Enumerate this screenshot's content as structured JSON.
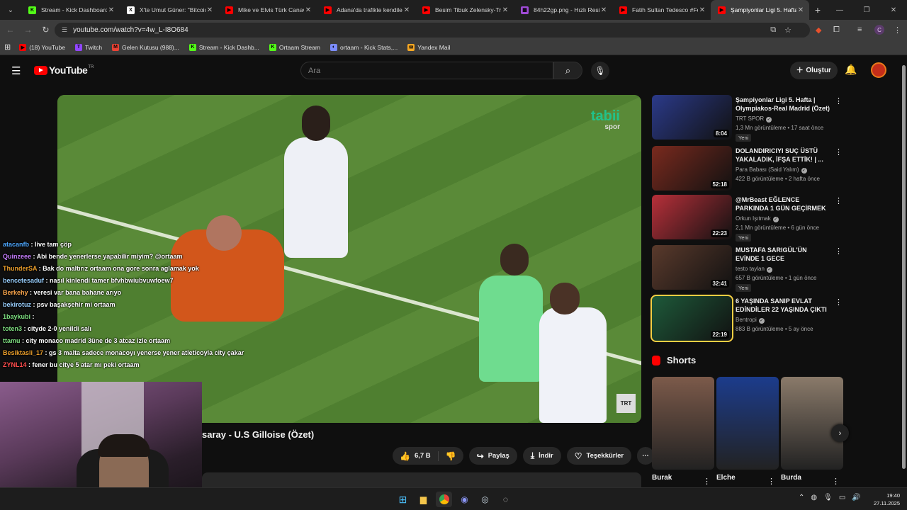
{
  "browser": {
    "tabs": [
      {
        "title": "Stream - Kick Dashboard",
        "icon": "kick-icon",
        "color": "#53fc18",
        "glyph": "K"
      },
      {
        "title": "X'te Umut Güner: \"Bitcoin",
        "icon": "x-icon",
        "color": "#ffffff",
        "glyph": "X"
      },
      {
        "title": "Mike ve Elvis Türk Canava",
        "icon": "youtube-icon",
        "color": "#ff0000",
        "glyph": "▶"
      },
      {
        "title": "Adana'da trafikte kendiler",
        "icon": "youtube-icon",
        "color": "#ff0000",
        "glyph": "▶"
      },
      {
        "title": "Besim Tibuk Zelensky-Tru",
        "icon": "youtube-icon",
        "color": "#ff0000",
        "glyph": "▶"
      },
      {
        "title": "84h22gp.png - Hızlı Resin",
        "icon": "image-host-icon",
        "color": "#a04bd6",
        "glyph": "▦"
      },
      {
        "title": "Fatih Sultan Tedesco #Fen",
        "icon": "youtube-icon",
        "color": "#ff0000",
        "glyph": "▶"
      },
      {
        "title": "Şampiyonlar Ligi 5. Hafta",
        "icon": "youtube-icon",
        "color": "#ff0000",
        "glyph": "▶"
      }
    ],
    "url": "youtube.com/watch?v=4w_L-I8O684",
    "profile_initial": "C",
    "bookmarks": [
      {
        "label": "(18) YouTube",
        "color": "#ff0000",
        "glyph": "▶"
      },
      {
        "label": "Twitch",
        "color": "#9146ff",
        "glyph": "T"
      },
      {
        "label": "Gelen Kutusu (988)...",
        "color": "#ea4335",
        "glyph": "M"
      },
      {
        "label": "Stream - Kick Dashb...",
        "color": "#53fc18",
        "glyph": "K"
      },
      {
        "label": "Ortaam Stream",
        "color": "#53fc18",
        "glyph": "K"
      },
      {
        "label": "ortaam - Kick Stats,...",
        "color": "#7b8cff",
        "glyph": "◐"
      },
      {
        "label": "Yandex Mail",
        "color": "#f5a623",
        "glyph": "✉"
      }
    ]
  },
  "youtube": {
    "logo_text": "YouTube",
    "country": "TR",
    "search_placeholder": "Ara",
    "create_label": "Oluştur",
    "video": {
      "watermark": "tabii",
      "watermark_sub": "spor",
      "channel_badge": "TRT SPOR",
      "title_visible": "saray - U.S Gilloise (Özet)",
      "likes": "6,7 B",
      "share_label": "Paylaş",
      "download_label": "İndir",
      "thanks_label": "Teşekkürler"
    },
    "recommendations": [
      {
        "title": "Şampiyonlar Ligi 5. Hafta | Olympiakos-Real Madrid (Özet)",
        "channel": "TRT SPOR",
        "views": "1,3 Mn görüntüleme",
        "age": "17 saat önce",
        "badge": "Yeni",
        "duration": "8:04",
        "thumb": "#2b3a8a"
      },
      {
        "title": "DOLANDIRICIYI SUÇ ÜSTÜ YAKALADIK, İFŞA ETTİK! | ...",
        "channel": "Para Babası (Said Yalım)",
        "views": "422 B görüntüleme",
        "age": "2 hafta önce",
        "badge": "",
        "duration": "52:18",
        "thumb": "#7a2a1e"
      },
      {
        "title": "@MrBeast  EĞLENCE PARKINDA 1 GÜN GEÇİRMEK",
        "channel": "Orkun Işıtmak",
        "views": "2,1 Mn görüntüleme",
        "age": "6 gün önce",
        "badge": "Yeni",
        "duration": "22:23",
        "thumb": "#b8303a"
      },
      {
        "title": "MUSTAFA SARIGÜL'ÜN EVİNDE 1 GECE",
        "channel": "testo taylan",
        "views": "657 B görüntüleme",
        "age": "1 gün önce",
        "badge": "Yeni",
        "duration": "32:41",
        "thumb": "#5a3a2c"
      },
      {
        "title": "6 YAŞINDA SANIP EVLAT EDİNDİLER 22 YAŞINDA ÇIKTI",
        "channel": "Bentropi",
        "views": "883 B görüntüleme",
        "age": "5 ay önce",
        "badge": "",
        "duration": "22:19",
        "thumb": "#1e5a3a"
      }
    ],
    "shorts_title": "Shorts",
    "shorts": [
      {
        "title": "Burak",
        "thumb": "#7c5a4a"
      },
      {
        "title": "Elche",
        "thumb": "#1c3c8c"
      },
      {
        "title": "Burda",
        "thumb": "#8a7a6a"
      }
    ]
  },
  "chat": [
    {
      "user": "atacanfb",
      "color": "#4ea8ff",
      "msg": "live tam çöp"
    },
    {
      "user": "Quinzeee",
      "color": "#c77dff",
      "msg": "Abi bende yenerlerse yapabilir miyim? @ortaam"
    },
    {
      "user": "ThunderSA",
      "color": "#e89c2a",
      "msg": "Bak do maltırız ortaam ona gore sonra aglamak yok"
    },
    {
      "user": "bencetesaduf",
      "color": "#9ad0ff",
      "msg": "nasıl kinlendi tamer bfvhbwiubvuwfoew7"
    },
    {
      "user": "Berkehy",
      "color": "#ffa94d",
      "msg": "veresi var bana bahane arıyo"
    },
    {
      "user": "bekirotuz",
      "color": "#9ad0ff",
      "msg": "psv başakşehir mi ortaam"
    },
    {
      "user": "1baykubi",
      "color": "#7ee081",
      "msg": ""
    },
    {
      "user": "toten3",
      "color": "#7ee081",
      "msg": "cityde 2-0 yenildi salı"
    },
    {
      "user": "ttamu",
      "color": "#7ee081",
      "msg": "city monaco madrid 3üne de 3 atcaz izle ortaam"
    },
    {
      "user": "Besiktasli_17",
      "color": "#e89c2a",
      "msg": "gs 3 malta sadece monacoyı yenerse yener atleticoyla city çakar"
    },
    {
      "user": "ZYNL14",
      "color": "#ff4d4d",
      "msg": "fener bu citye 5 atar mı peki ortaam"
    }
  ],
  "taskbar": {
    "time": "19:40",
    "date": "27.11.2025"
  }
}
